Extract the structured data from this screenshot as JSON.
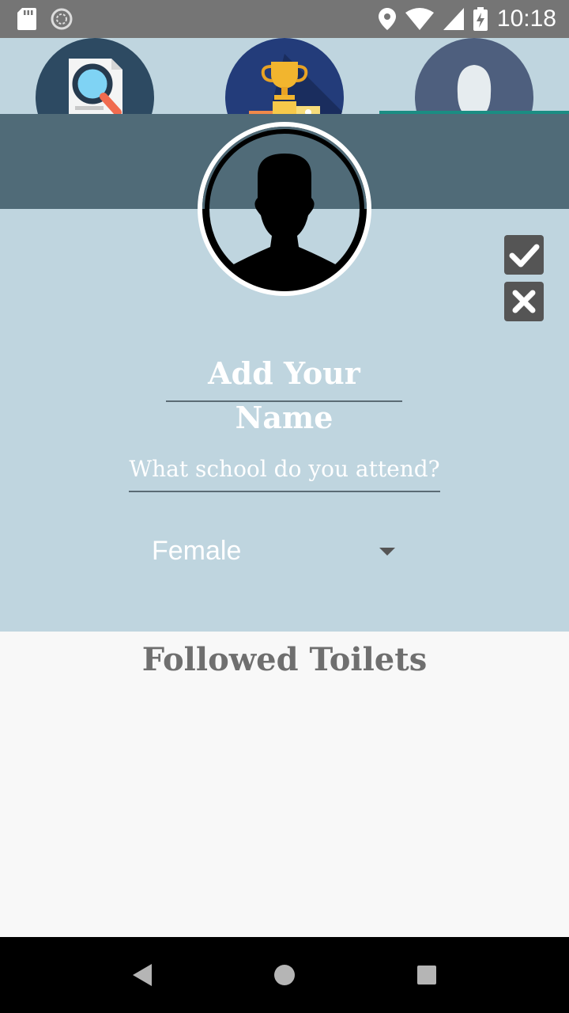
{
  "status_bar": {
    "time": "10:18",
    "icons": [
      "sd-card-icon",
      "sync-icon",
      "location-icon",
      "wifi-icon",
      "signal-icon",
      "battery-charging-icon"
    ]
  },
  "tabs": [
    {
      "icon": "search-document-icon",
      "selected": false
    },
    {
      "icon": "trophy-podium-icon",
      "selected": false
    },
    {
      "icon": "profile-person-icon",
      "selected": true
    }
  ],
  "profile": {
    "avatar_icon": "person-silhouette-icon",
    "name_placeholder": "Add Your Name",
    "school_placeholder": "What school do you attend?",
    "gender_selected": "Female",
    "accept_icon": "check-icon",
    "reject_icon": "close-icon"
  },
  "followed": {
    "title": "Followed Toilets"
  },
  "nav_bar": {
    "icons": [
      "back-icon",
      "home-icon",
      "recents-icon"
    ]
  },
  "colors": {
    "status_bar": "#757575",
    "header_band": "#506b78",
    "profile_bg": "#bfd5df",
    "tab_indicator": "#1b8d83",
    "page_bg": "#f8f8f8"
  }
}
